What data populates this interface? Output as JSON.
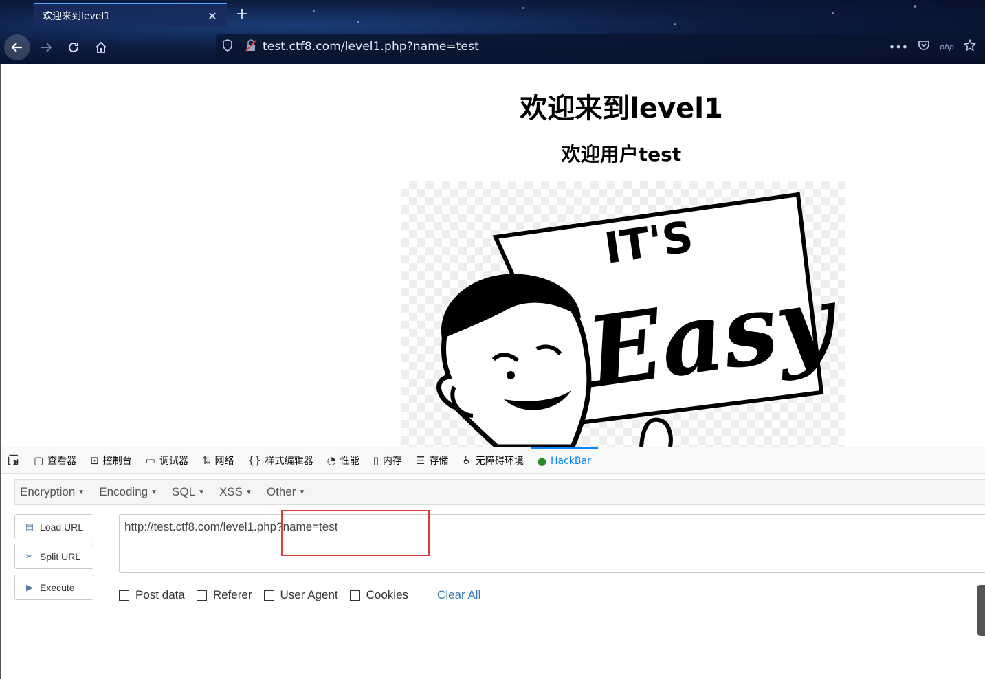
{
  "browser": {
    "tab_title": "欢迎来到level1",
    "tab_close": "✕",
    "new_tab": "+",
    "url": "test.ctf8.com/level1.php?name=test",
    "overflow_menu": "•••",
    "php_badge": "php"
  },
  "page": {
    "heading": "欢迎来到level1",
    "subheading": "欢迎用户test",
    "image_text_top": "IT'S",
    "image_text_main": "Easy"
  },
  "devtools": {
    "tabs": [
      {
        "label": "查看器",
        "icon": "inspector-icon"
      },
      {
        "label": "控制台",
        "icon": "console-icon"
      },
      {
        "label": "调试器",
        "icon": "debugger-icon"
      },
      {
        "label": "网络",
        "icon": "network-icon"
      },
      {
        "label": "样式编辑器",
        "icon": "style-editor-icon"
      },
      {
        "label": "性能",
        "icon": "performance-icon"
      },
      {
        "label": "内存",
        "icon": "memory-icon"
      },
      {
        "label": "存储",
        "icon": "storage-icon"
      },
      {
        "label": "无障碍环境",
        "icon": "accessibility-icon"
      },
      {
        "label": "HackBar",
        "icon": "hackbar-icon"
      }
    ],
    "active_tab": "HackBar"
  },
  "hackbar": {
    "menu": [
      "Encryption",
      "Encoding",
      "SQL",
      "XSS",
      "Other"
    ],
    "buttons": {
      "load": "Load URL",
      "split": "Split URL",
      "execute": "Execute"
    },
    "url_value": "http://test.ctf8.com/level1.php?name=test",
    "options": [
      "Post data",
      "Referer",
      "User Agent",
      "Cookies"
    ],
    "clear_all": "Clear All",
    "highlight_color": "#e53935"
  }
}
